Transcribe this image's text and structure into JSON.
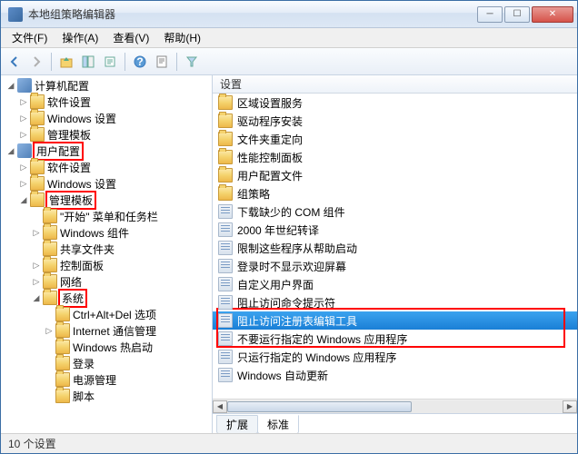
{
  "window": {
    "title": "本地组策略编辑器"
  },
  "titlebar_buttons": {
    "min": "─",
    "max": "☐",
    "close": "✕"
  },
  "menu": {
    "file": "文件(F)",
    "action": "操作(A)",
    "view": "查看(V)",
    "help": "帮助(H)"
  },
  "tree": {
    "root1": "计算机配置",
    "r1_software": "软件设置",
    "r1_windows": "Windows 设置",
    "r1_templates": "管理模板",
    "root2": "用户配置",
    "r2_software": "软件设置",
    "r2_windows": "Windows 设置",
    "r2_templates": "管理模板",
    "t_start": "\"开始\" 菜单和任务栏",
    "t_wincomp": "Windows 组件",
    "t_shared": "共享文件夹",
    "t_cp": "控制面板",
    "t_net": "网络",
    "t_sys": "系统",
    "s_ctrlaltdel": "Ctrl+Alt+Del 选项",
    "s_ie": "Internet 通信管理",
    "s_hotstart": "Windows 热启动",
    "s_login": "登录",
    "s_power": "电源管理",
    "s_script": "脚本"
  },
  "list": {
    "header": "设置",
    "items": [
      {
        "type": "folder",
        "label": "区域设置服务"
      },
      {
        "type": "folder",
        "label": "驱动程序安装"
      },
      {
        "type": "folder",
        "label": "文件夹重定向"
      },
      {
        "type": "folder",
        "label": "性能控制面板"
      },
      {
        "type": "folder",
        "label": "用户配置文件"
      },
      {
        "type": "folder",
        "label": "组策略"
      },
      {
        "type": "setting",
        "label": "下载缺少的 COM 组件"
      },
      {
        "type": "setting",
        "label": "2000 年世纪转译"
      },
      {
        "type": "setting",
        "label": "限制这些程序从帮助启动"
      },
      {
        "type": "setting",
        "label": "登录时不显示欢迎屏幕"
      },
      {
        "type": "setting",
        "label": "自定义用户界面"
      },
      {
        "type": "setting",
        "label": "阻止访问命令提示符"
      },
      {
        "type": "setting",
        "label": "阻止访问注册表编辑工具",
        "selected": true
      },
      {
        "type": "setting",
        "label": "不要运行指定的 Windows 应用程序"
      },
      {
        "type": "setting",
        "label": "只运行指定的 Windows 应用程序"
      },
      {
        "type": "setting",
        "label": "Windows 自动更新"
      }
    ]
  },
  "tabs": {
    "extended": "扩展",
    "standard": "标准"
  },
  "status": "10 个设置"
}
